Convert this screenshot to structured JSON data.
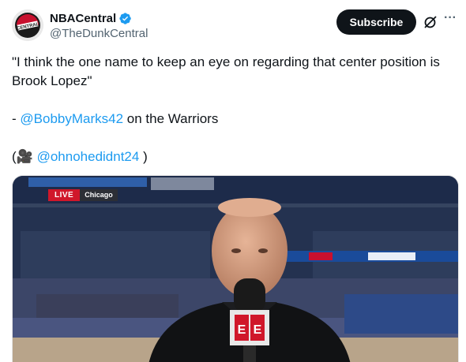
{
  "author": {
    "display_name": "NBACentral",
    "handle": "@TheDunkCentral",
    "avatar_text": "CENTRAL",
    "verified_icon": "verified-badge-icon"
  },
  "actions": {
    "subscribe_label": "Subscribe",
    "grok_icon": "grok-icon",
    "more_icon": "more-options-icon",
    "more_glyph": "···"
  },
  "tweet": {
    "line1": "\"I think the one name to keep an eye on regarding that center position is Brook Lopez\"",
    "dash": "- ",
    "mention1": "@BobbyMarks42",
    "line2_rest": " on the Warriors",
    "open_paren": "(",
    "camera_glyph": "🎥",
    "mention2": "@ohnohedidnt24",
    "close_paren": " )"
  },
  "media": {
    "live_label": "LIVE",
    "city_label": "Chicago",
    "mic_logo_text": "E"
  },
  "colors": {
    "link": "#1d9bf0",
    "button_bg": "#0f1419",
    "secondary_text": "#536471",
    "live_red": "#d0172a"
  }
}
